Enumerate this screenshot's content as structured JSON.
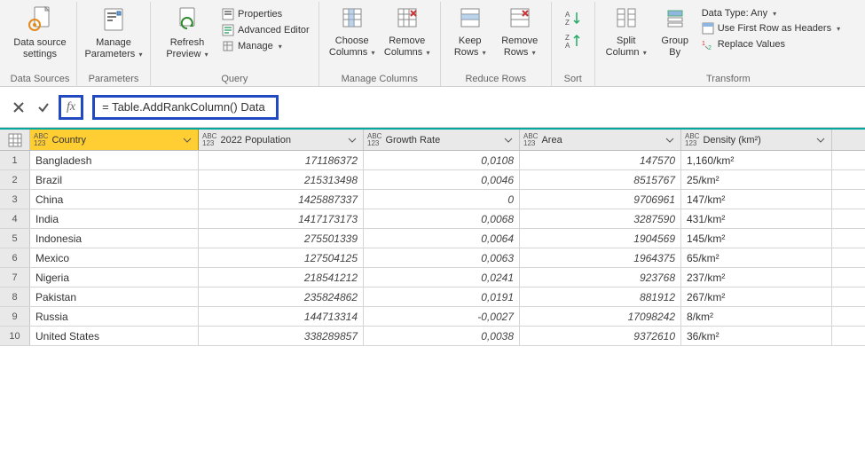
{
  "ribbon": {
    "groups": {
      "data_sources": {
        "label": "Data Sources",
        "btn": "Data source\nsettings"
      },
      "parameters": {
        "label": "Parameters",
        "btn": "Manage\nParameters"
      },
      "query": {
        "label": "Query",
        "refresh": "Refresh\nPreview",
        "properties": "Properties",
        "advanced_editor": "Advanced Editor",
        "manage": "Manage"
      },
      "manage_columns": {
        "label": "Manage Columns",
        "choose": "Choose\nColumns",
        "remove": "Remove\nColumns"
      },
      "reduce_rows": {
        "label": "Reduce Rows",
        "keep": "Keep\nRows",
        "remove": "Remove\nRows"
      },
      "sort": {
        "label": "Sort"
      },
      "transform": {
        "label": "Transform",
        "split": "Split\nColumn",
        "group": "Group\nBy",
        "data_type": "Data Type: Any",
        "first_row": "Use First Row as Headers",
        "replace": "Replace Values"
      }
    }
  },
  "formula_bar": {
    "fx": "fx",
    "formula": "= Table.AddRankColumn() Data"
  },
  "columns": {
    "country": "Country",
    "population": "2022 Population",
    "growth": "Growth Rate",
    "area": "Area",
    "density": "Density (km²)",
    "type_label": "ABC\n123"
  },
  "rows": [
    {
      "idx": "1",
      "country": "Bangladesh",
      "population": "171186372",
      "growth": "0,0108",
      "area": "147570",
      "density": "1,160/km²"
    },
    {
      "idx": "2",
      "country": "Brazil",
      "population": "215313498",
      "growth": "0,0046",
      "area": "8515767",
      "density": "25/km²"
    },
    {
      "idx": "3",
      "country": "China",
      "population": "1425887337",
      "growth": "0",
      "area": "9706961",
      "density": "147/km²"
    },
    {
      "idx": "4",
      "country": "India",
      "population": "1417173173",
      "growth": "0,0068",
      "area": "3287590",
      "density": "431/km²"
    },
    {
      "idx": "5",
      "country": "Indonesia",
      "population": "275501339",
      "growth": "0,0064",
      "area": "1904569",
      "density": "145/km²"
    },
    {
      "idx": "6",
      "country": "Mexico",
      "population": "127504125",
      "growth": "0,0063",
      "area": "1964375",
      "density": "65/km²"
    },
    {
      "idx": "7",
      "country": "Nigeria",
      "population": "218541212",
      "growth": "0,0241",
      "area": "923768",
      "density": "237/km²"
    },
    {
      "idx": "8",
      "country": "Pakistan",
      "population": "235824862",
      "growth": "0,0191",
      "area": "881912",
      "density": "267/km²"
    },
    {
      "idx": "9",
      "country": "Russia",
      "population": "144713314",
      "growth": "-0,0027",
      "area": "17098242",
      "density": "8/km²"
    },
    {
      "idx": "10",
      "country": "United States",
      "population": "338289857",
      "growth": "0,0038",
      "area": "9372610",
      "density": "36/km²"
    }
  ]
}
